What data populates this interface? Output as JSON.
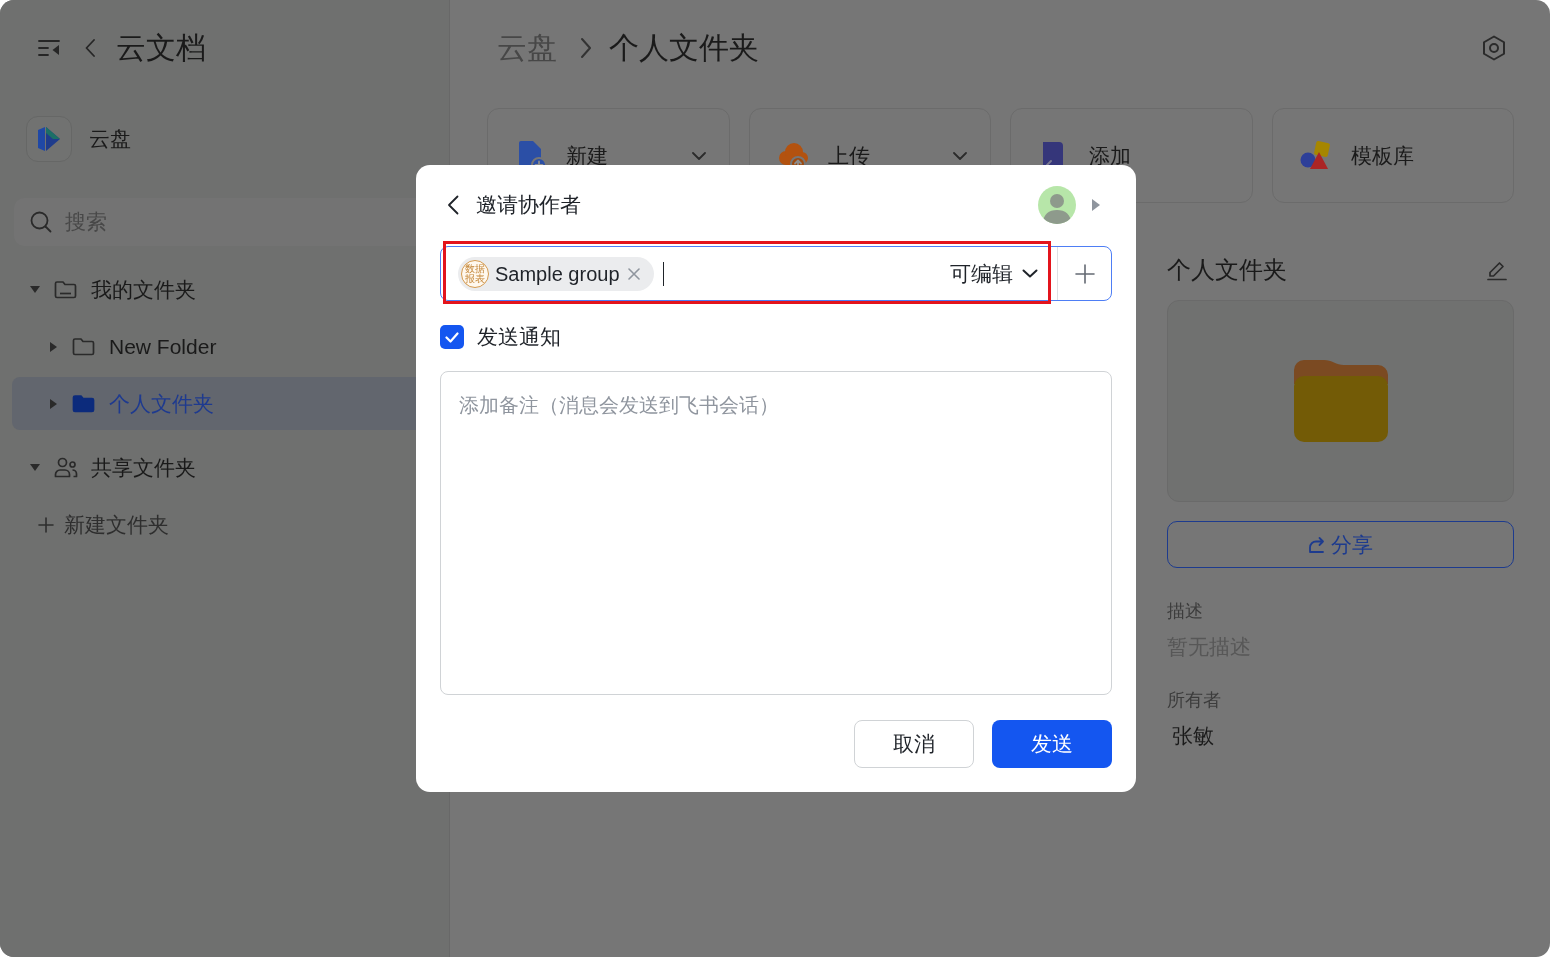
{
  "sidebar": {
    "title": "云文档",
    "space": {
      "name": "云盘"
    },
    "search": {
      "placeholder": "搜索"
    },
    "tree": [
      {
        "label": "我的文件夹",
        "kind": "drive",
        "expanded": true,
        "selected": false,
        "children": [
          {
            "label": "New Folder",
            "kind": "folder",
            "expanded": false,
            "selected": false
          },
          {
            "label": "个人文件夹",
            "kind": "folder",
            "expanded": false,
            "selected": true
          }
        ]
      },
      {
        "label": "共享文件夹",
        "kind": "shared",
        "expanded": true,
        "selected": false
      }
    ],
    "new_folder": {
      "label": "新建文件夹"
    }
  },
  "breadcrumb": [
    {
      "label": "云盘"
    },
    {
      "label": "个人文件夹"
    }
  ],
  "actions": [
    {
      "label": "新建",
      "kind": "new",
      "dropdown": true
    },
    {
      "label": "上传",
      "kind": "upload",
      "dropdown": true
    },
    {
      "label": "添加",
      "kind": "add",
      "dropdown": false
    },
    {
      "label": "模板库",
      "kind": "templates",
      "dropdown": false
    }
  ],
  "details": {
    "title": "个人文件夹",
    "share": "分享",
    "fields": [
      {
        "label": "描述",
        "value": "暂无描述",
        "empty": true
      },
      {
        "label": "所有者",
        "value": "张敏",
        "empty": false
      }
    ]
  },
  "dialog": {
    "title": "邀请协作者",
    "invite": {
      "chips": [
        {
          "label": "Sample group",
          "avatar": "数据报表"
        }
      ],
      "permission": "可编辑",
      "highlighted": true
    },
    "notify": {
      "label": "发送通知",
      "checked": true
    },
    "note": {
      "placeholder": "添加备注（消息会发送到飞书会话）"
    },
    "buttons": [
      {
        "label": "取消",
        "kind": "secondary"
      },
      {
        "label": "发送",
        "kind": "primary"
      }
    ]
  }
}
